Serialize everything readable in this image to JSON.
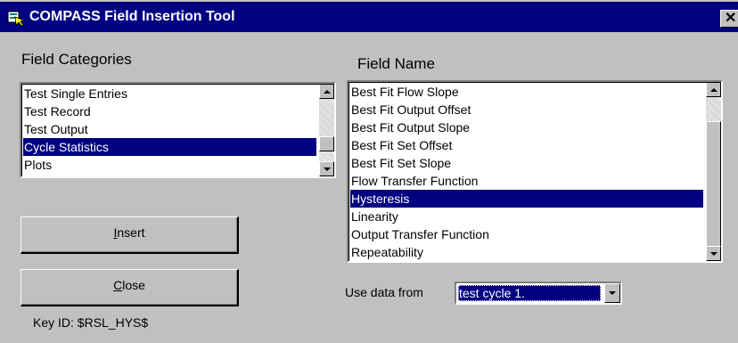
{
  "window": {
    "title": "COMPASS Field Insertion Tool",
    "close_glyph": "✕",
    "icon": "app-icon"
  },
  "categories": {
    "label": "Field Categories",
    "items": [
      "Test Single Entries",
      "Test Record",
      "Test Output",
      "Cycle Statistics",
      "Plots"
    ],
    "selected_index": 3
  },
  "fields": {
    "label": "Field Name",
    "items": [
      "Best Fit Flow Slope",
      "Best Fit Output Offset",
      "Best Fit Output Slope",
      "Best Fit Set Offset",
      "Best Fit Set Slope",
      "Flow Transfer Function",
      "Hysteresis",
      "Linearity",
      "Output Transfer Function",
      "Repeatability"
    ],
    "selected_index": 6
  },
  "buttons": {
    "insert_accel": "I",
    "insert_rest": "nsert",
    "close_accel": "C",
    "close_rest": "lose"
  },
  "use_data": {
    "label": "Use data from",
    "value": "test cycle 1."
  },
  "key_id": "Key ID: $RSL_HYS$",
  "colors": {
    "titlebar": "#000080",
    "selection": "#000080",
    "face": "#c0c0c0"
  }
}
